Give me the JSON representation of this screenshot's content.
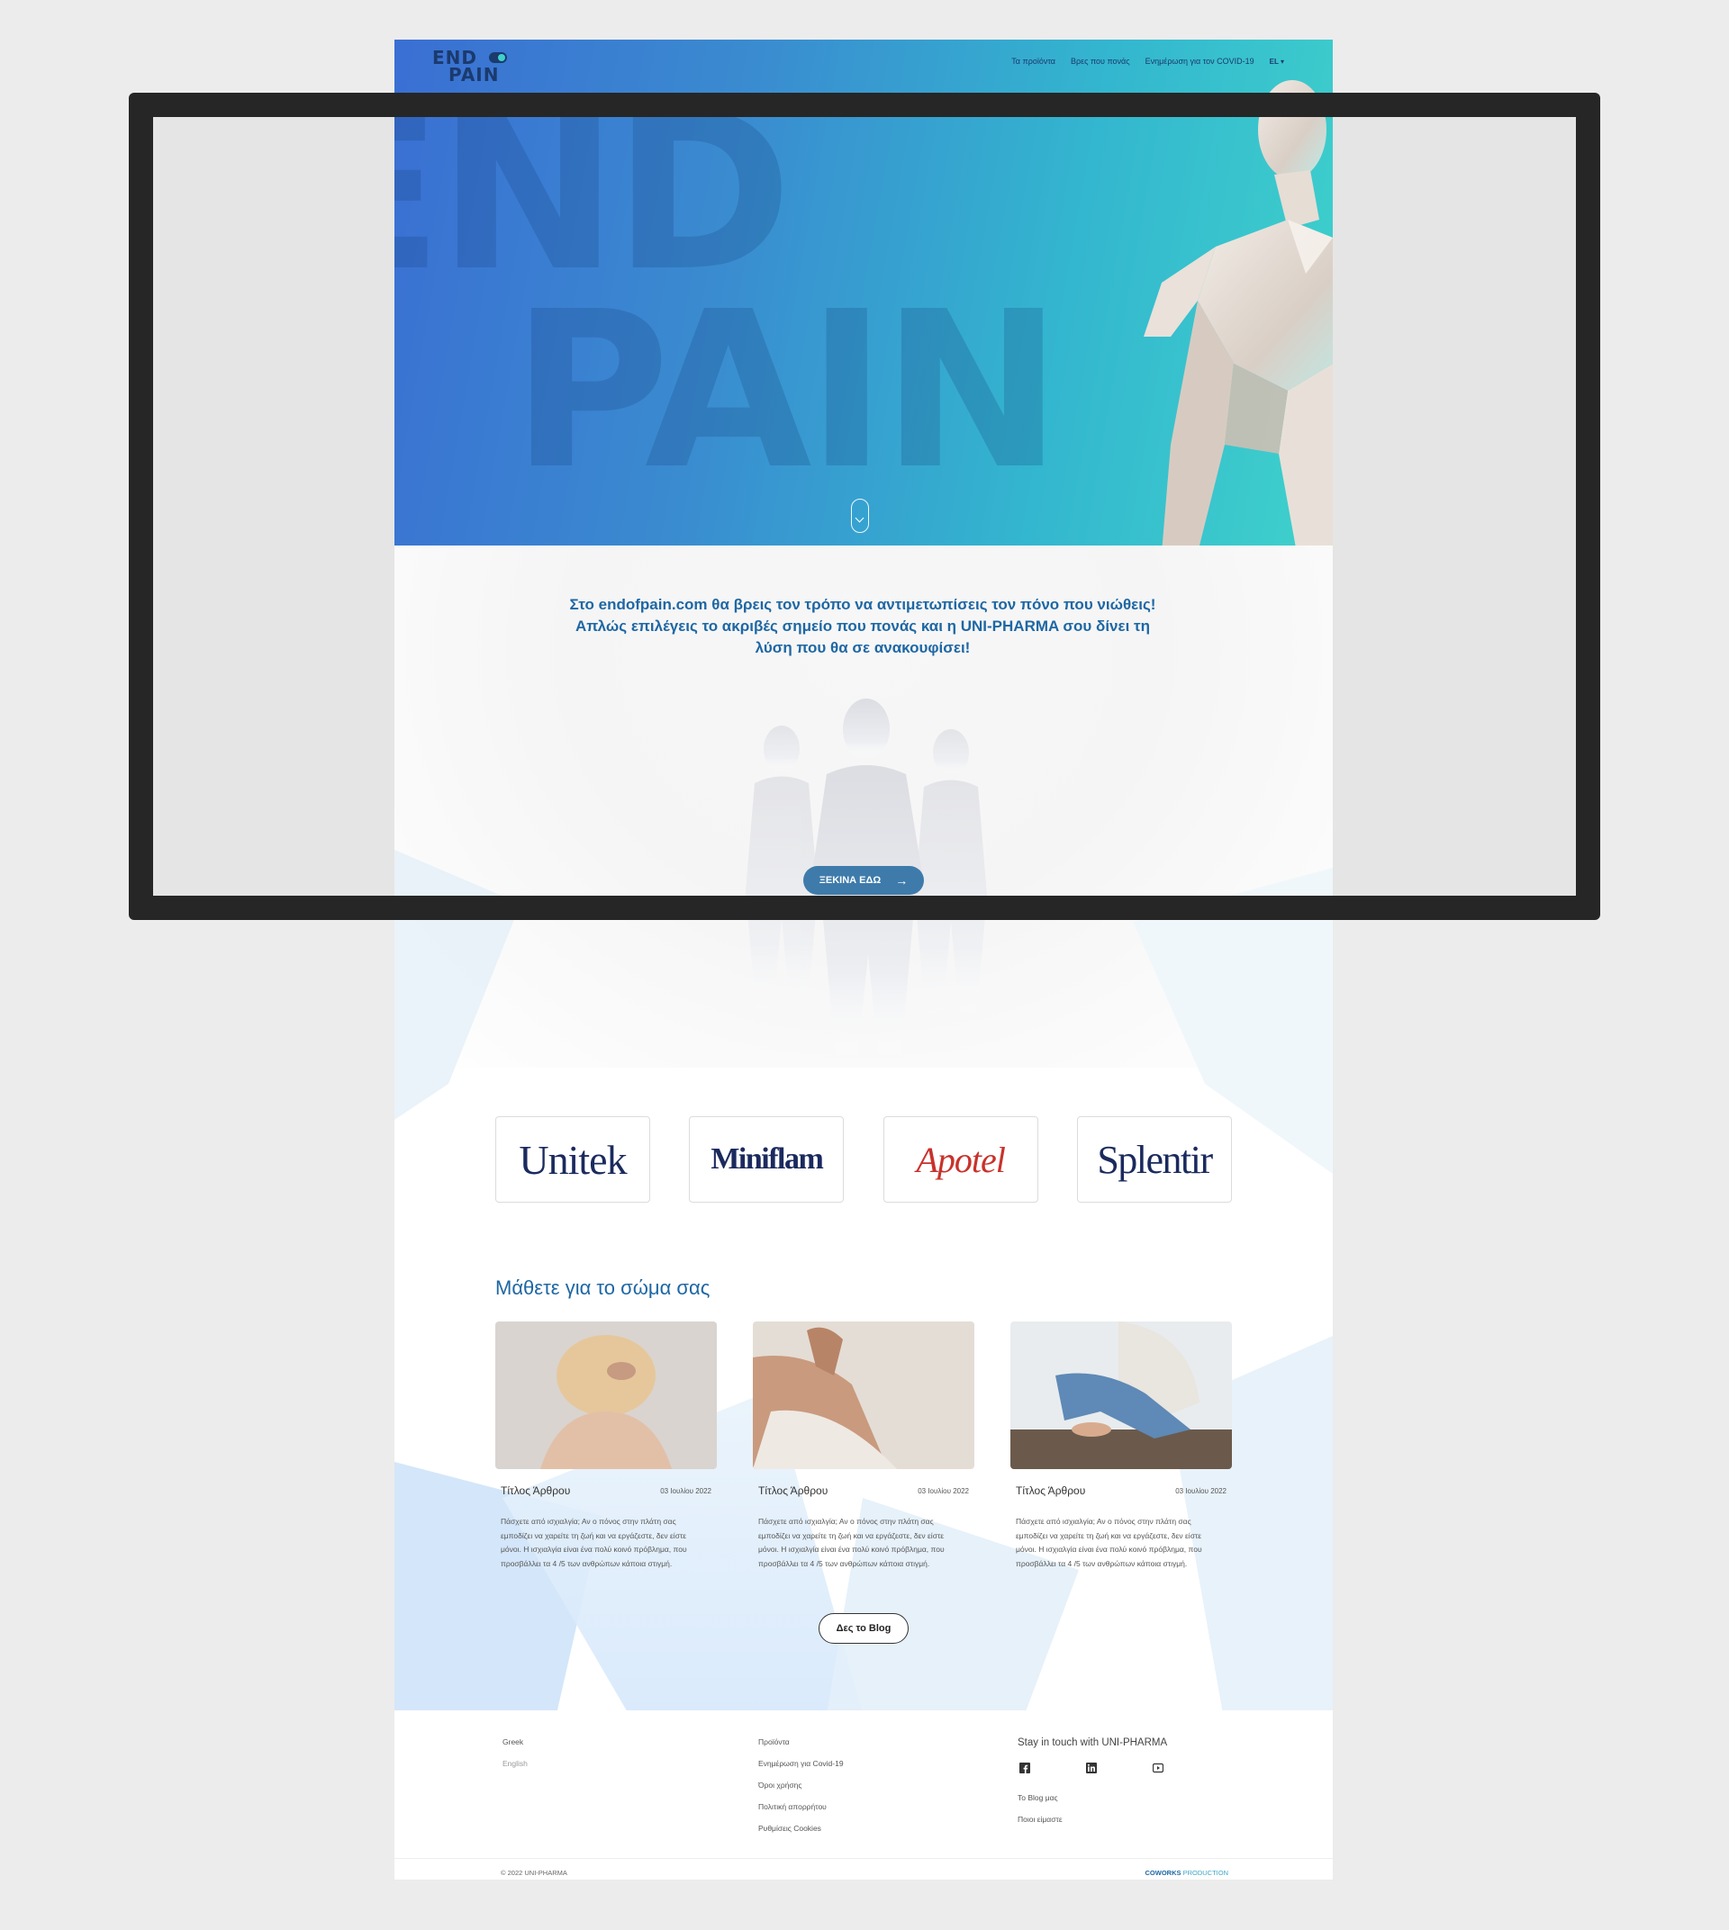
{
  "nav": {
    "links": [
      "Τα προϊόντα",
      "Βρες που πονάς",
      "Ενημέρωση για τον COVID-19"
    ],
    "lang": "EL ▾"
  },
  "logo": {
    "line1": "END",
    "line2": "PAIN"
  },
  "hero": {
    "big_line1": "END",
    "big_line2": "PAIN"
  },
  "intro": {
    "text": "Στο endofpain.com θα βρεις τον τρόπο να αντιμετωπίσεις τον πόνο που νιώθεις! Απλώς επιλέγεις το ακριβές σημείο που πονάς και η UNI-PHARMA σου δίνει τη λύση που θα σε ανακουφίσει!",
    "cta": "ΞΕΚΙΝΑ ΕΔΩ",
    "cta_arrow": "→"
  },
  "brands": [
    {
      "name": "Unitek"
    },
    {
      "name": "Miniflam"
    },
    {
      "name": "Apotel"
    },
    {
      "name": "Splentir"
    }
  ],
  "blog": {
    "title": "Μάθετε για το σώμα σας",
    "cards": [
      {
        "title": "Τίτλος Άρθρου",
        "date": "03 Ιουλίου 2022",
        "body": "Πάσχετε από ισχιαλγία; Αν ο πόνος στην πλάτη σας εμποδίζει να χαρείτε τη ζωή και να εργάζεστε, δεν είστε μόνοι. Η ισχιαλγία είναι ένα πολύ κοινό πρόβλημα, που προσβάλλει τα 4 /5 των ανθρώπων κάποια στιγμή."
      },
      {
        "title": "Τίτλος Άρθρου",
        "date": "03 Ιουλίου 2022",
        "body": "Πάσχετε από ισχιαλγία; Αν ο πόνος στην πλάτη σας εμποδίζει να χαρείτε τη ζωή και να εργάζεστε, δεν είστε μόνοι. Η ισχιαλγία είναι ένα πολύ κοινό πρόβλημα, που προσβάλλει τα 4 /5 των ανθρώπων κάποια στιγμή."
      },
      {
        "title": "Τίτλος Άρθρου",
        "date": "03 Ιουλίου 2022",
        "body": "Πάσχετε από ισχιαλγία; Αν ο πόνος στην πλάτη σας εμποδίζει να χαρείτε τη ζωή και να εργάζεστε, δεν είστε μόνοι. Η ισχιαλγία είναι ένα πολύ κοινό πρόβλημα, που προσβάλλει τα 4 /5 των ανθρώπων κάποια στιγμή."
      }
    ],
    "button": "Δες το Blog"
  },
  "footer": {
    "languages": [
      "Greek",
      "English"
    ],
    "links": [
      "Προϊόντα",
      "Ενημέρωση για Covid-19",
      "Όροι χρήσης",
      "Πολιτική απορρήτου",
      "Ρυθμίσεις Cookies"
    ],
    "stay": "Stay in touch with UNI-PHARMA",
    "social_icons": [
      "facebook-icon",
      "linkedin-icon",
      "youtube-icon"
    ],
    "extra_links": [
      "Το Blog μας",
      "Ποιοι είμαστε"
    ],
    "copyright": "© 2022 UNI-PHARMA",
    "credit_strong": "COWORKS",
    "credit_rest": " PRODUCTION"
  },
  "colors": {
    "accent": "#1e67a4",
    "hero_start": "#3a6fd3",
    "hero_end": "#3fd2cb",
    "cta": "#3e7bab",
    "apotel_red": "#c8322b",
    "brand_navy": "#1b2a5e",
    "monitor_frame": "#262626"
  }
}
